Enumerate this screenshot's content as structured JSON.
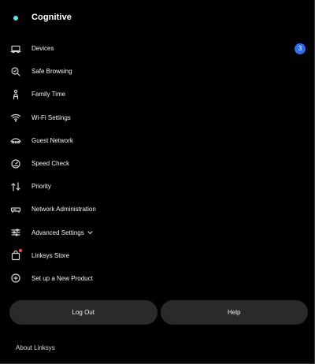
{
  "header": {
    "title": "Cognitive",
    "status_color": "#5ee6ef"
  },
  "menu": {
    "items": [
      {
        "label": "Devices",
        "icon": "devices-icon",
        "badge": "3"
      },
      {
        "label": "Safe Browsing",
        "icon": "safe-browsing-icon"
      },
      {
        "label": "Family Time",
        "icon": "family-time-icon"
      },
      {
        "label": "Wi-Fi Settings",
        "icon": "wifi-icon"
      },
      {
        "label": "Guest Network",
        "icon": "guest-network-icon"
      },
      {
        "label": "Speed Check",
        "icon": "speedometer-icon"
      },
      {
        "label": "Priority",
        "icon": "priority-arrows-icon"
      },
      {
        "label": "Network Administration",
        "icon": "router-icon"
      },
      {
        "label": "Advanced Settings",
        "icon": "sliders-icon",
        "expandable": true
      },
      {
        "label": "Linksys Store",
        "icon": "shopping-bag-icon",
        "notification": true
      },
      {
        "label": "Set up a New Product",
        "icon": "add-circle-icon"
      }
    ]
  },
  "actions": {
    "logout_label": "Log Out",
    "help_label": "Help"
  },
  "footer": {
    "about_label": "About Linksys"
  },
  "colors": {
    "background": "#000000",
    "badge": "#2f6df0",
    "notification": "#ff4d4d",
    "button": "#2a2a2a"
  }
}
